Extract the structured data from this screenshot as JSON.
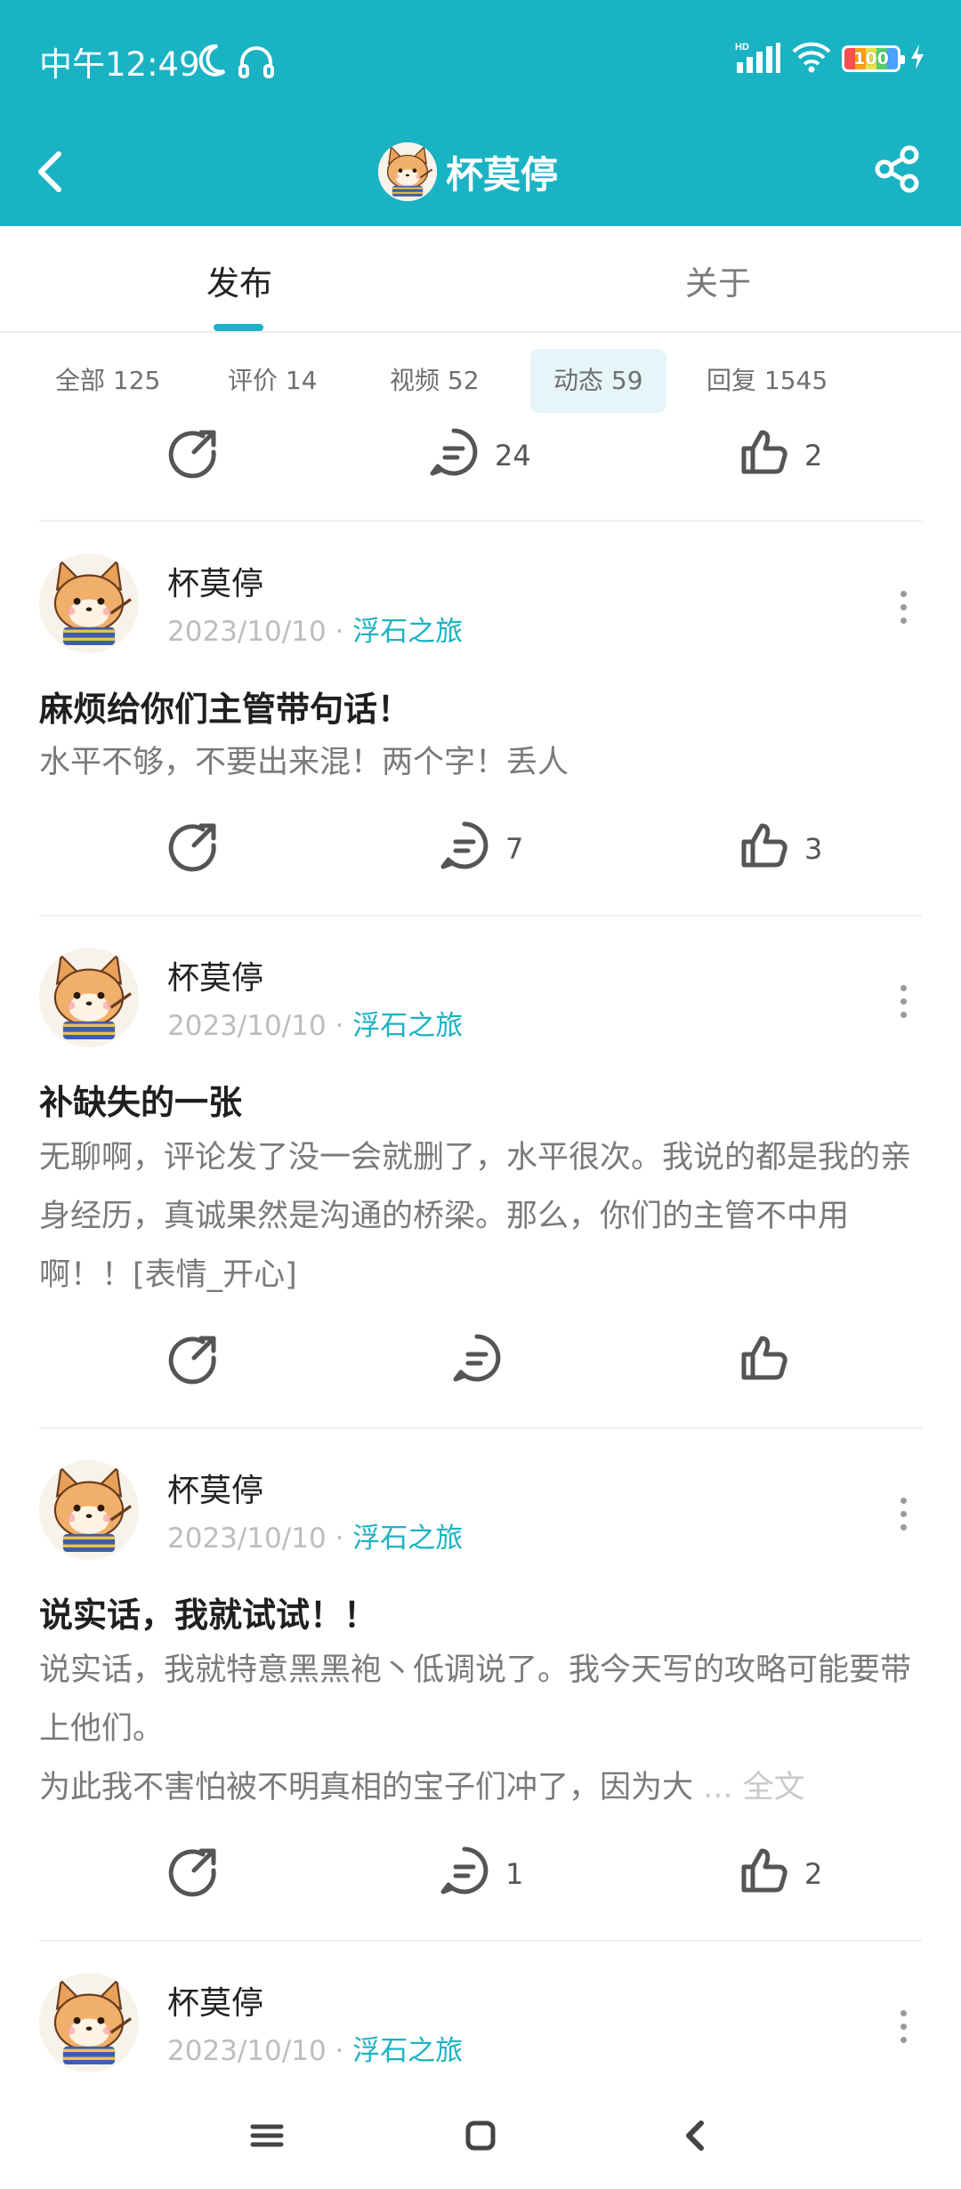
{
  "status_bar": {
    "time": "中午12:49",
    "battery": "100"
  },
  "nav": {
    "title": "杯莫停"
  },
  "tabs": [
    {
      "label": "发布"
    },
    {
      "label": "关于"
    }
  ],
  "filters": [
    {
      "label": "全部 125"
    },
    {
      "label": "评价 14"
    },
    {
      "label": "视频 52"
    },
    {
      "label": "动态 59"
    },
    {
      "label": "回复 1545"
    }
  ],
  "top_actions": {
    "comments": "24",
    "likes": "2"
  },
  "posts": [
    {
      "author": "杯莫停",
      "date": "2023/10/10",
      "separator": "·",
      "game": "浮石之旅",
      "title": "麻烦给你们主管带句话！",
      "body": "水平不够，不要出来混！两个字！丢人",
      "comments": "7",
      "likes": "3"
    },
    {
      "author": "杯莫停",
      "date": "2023/10/10",
      "separator": "·",
      "game": "浮石之旅",
      "title": "补缺失的一张",
      "body": "无聊啊，评论发了没一会就删了，水平很次。我说的都是我的亲身经历，真诚果然是沟通的桥梁。那么，你们的主管不中用啊！！[表情_开心]",
      "comments": "",
      "likes": ""
    },
    {
      "author": "杯莫停",
      "date": "2023/10/10",
      "separator": "·",
      "game": "浮石之旅",
      "title": "说实话，我就试试！！",
      "body": "说实话，我就特意黑黑袍丶低调说了。我今天写的攻略可能要带上他们。",
      "body_line3": " 为此我不害怕被不明真相的宝子们冲了，因为大",
      "ellipsis": " ... ",
      "fulltext_label": "全文",
      "comments": "1",
      "likes": "2"
    },
    {
      "author": "杯莫停",
      "date": "2023/10/10",
      "separator": "·",
      "game": "浮石之旅"
    }
  ],
  "icons": {
    "back": "back-arrow-icon",
    "share": "share-icon",
    "repost": "repost-icon",
    "comment": "comment-icon",
    "like": "thumbs-up-icon",
    "more": "more-vertical-icon"
  },
  "colors": {
    "accent": "#1ab3c3",
    "text_primary": "#222222",
    "text_secondary": "#7a7a7a",
    "text_muted": "#bdbdbd"
  }
}
